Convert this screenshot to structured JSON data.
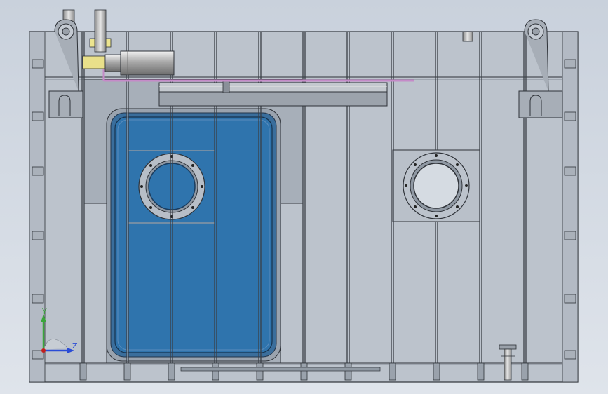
{
  "view": {
    "background": "#d3dae3",
    "panel_fill": "#b4bcc6",
    "outline": "#2e3238",
    "frame_fill": "#a9b1bb",
    "window_fill": "#2d6fa5",
    "window_dark": "#1f4f7a",
    "pipe_color": "#c58bc8"
  },
  "triad": {
    "y_label": "Y",
    "z_label": "Z",
    "y_color": "#3aa63a",
    "z_color": "#2a4cd6",
    "origin_color": "#c21f1f"
  }
}
